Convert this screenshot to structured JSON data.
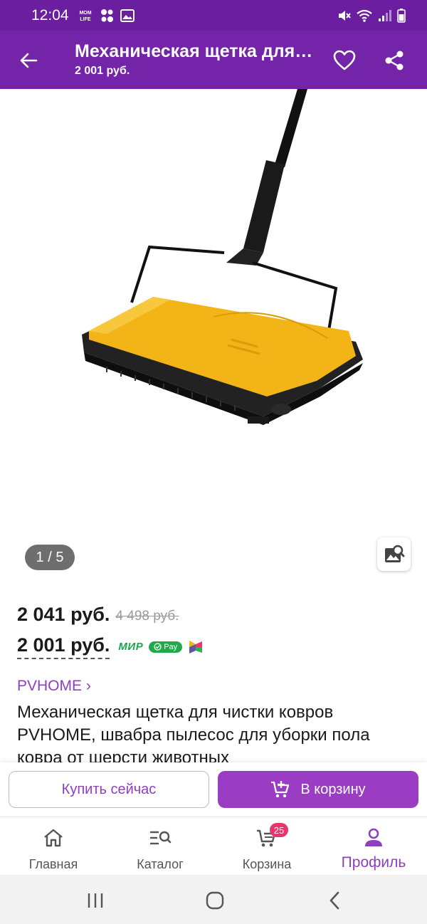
{
  "status_bar": {
    "time": "12:04",
    "mom_life_icon": "MOM LIFE",
    "icons_left": [
      "mom-life-icon",
      "dots-icon",
      "gallery-icon"
    ],
    "icons_right": [
      "mute-icon",
      "wifi-icon",
      "signal-icon",
      "battery-icon"
    ]
  },
  "app_bar": {
    "title": "Механическая щетка для чистки ковров",
    "subtitle": "2 001 руб.",
    "icons": [
      "back-arrow-icon",
      "heart-icon",
      "share-icon"
    ]
  },
  "gallery": {
    "counter": "1 / 5",
    "search_icon": "image-search-icon"
  },
  "prices": {
    "main": "2 041 руб.",
    "old": "4 498 руб.",
    "card": "2 001 руб.",
    "mir": "МИР",
    "pay": "Pay"
  },
  "product": {
    "brand": "PVHOME ›",
    "description": "Механическая щетка для чистки ковров PVHOME, швабра пылесос для уборки пола ковра от шерсти животных"
  },
  "actions": {
    "buy_now": "Купить сейчас",
    "to_cart": "В корзину"
  },
  "bottom_nav": {
    "items": [
      {
        "label": "Главная",
        "icon": "home-icon"
      },
      {
        "label": "Каталог",
        "icon": "catalog-search-icon"
      },
      {
        "label": "Корзина",
        "icon": "cart-icon",
        "badge": "25"
      },
      {
        "label": "Профиль",
        "icon": "profile-icon",
        "active": true
      }
    ]
  },
  "colors": {
    "brand_purple": "#7424a8",
    "accent_purple": "#9b3dc4",
    "badge_pink": "#e8356b",
    "product_yellow": "#f2b416"
  }
}
